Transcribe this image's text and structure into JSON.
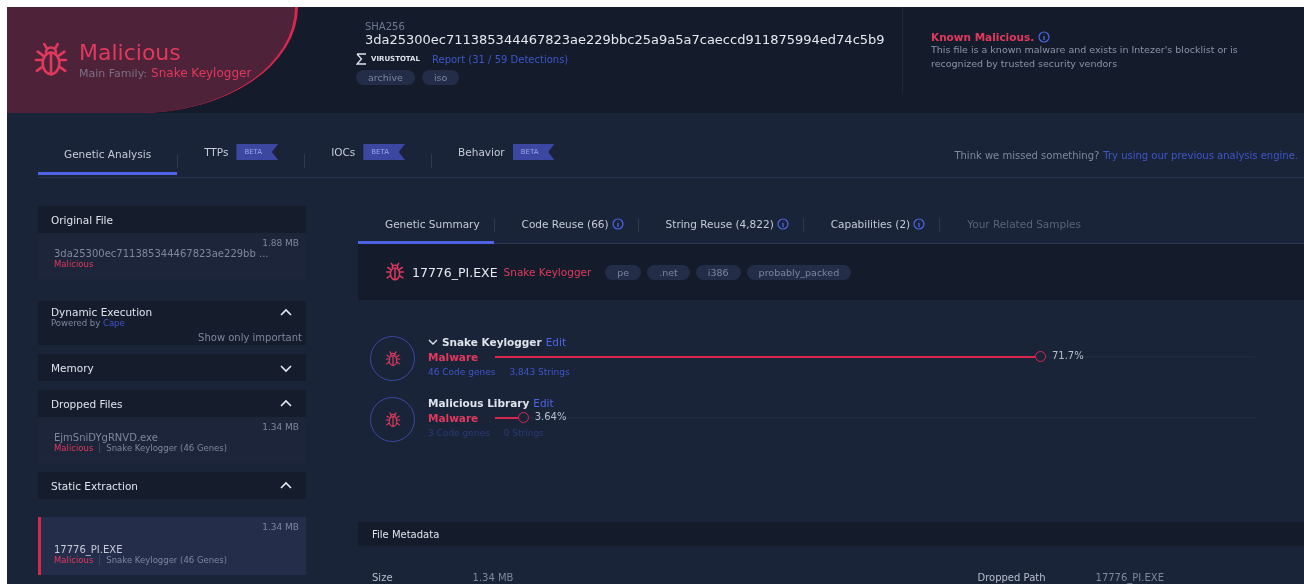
{
  "verdict": {
    "title": "Malicious",
    "family_label": "Main Family:",
    "family": "Snake Keylogger"
  },
  "file": {
    "hash_label": "SHA256",
    "hash": "3da25300ec711385344467823ae229bbc25a9a5a7caeccd911875994ed74c5b9",
    "vt_label": "VIRUSTOTAL",
    "vt_link": "Report (31 / 59 Detections)",
    "tags": [
      "archive",
      "iso"
    ]
  },
  "notice": {
    "title": "Known Malicious.",
    "text": "This file is a known malware and exists in Intezer's blocklist or is recognized by trusted security vendors"
  },
  "tabs": [
    {
      "label": "Genetic Analysis",
      "selected": true
    },
    {
      "label": "TTPs",
      "badge": "BETA",
      "selected": false
    },
    {
      "label": "IOCs",
      "badge": "BETA",
      "selected": false
    },
    {
      "label": "Behavior",
      "badge": "BETA",
      "selected": false
    }
  ],
  "hint": {
    "text": "Think we missed something?",
    "link": "Try using our previous analysis engine."
  },
  "sidebar": {
    "sections": [
      {
        "title": "Original File",
        "kind": "plain",
        "files": [
          {
            "name": "3da25300ec711385344467823ae229bb ...",
            "size": "1.88 MB",
            "verdict": "Malicious",
            "selected": false
          }
        ]
      },
      {
        "title": "Dynamic Execution",
        "kind": "toggle",
        "subtitle": "Powered by",
        "subtitle_link": "Cape",
        "action": "Show only important",
        "expanded": true
      },
      {
        "title": "Memory",
        "kind": "toggle",
        "expanded": false
      },
      {
        "title": "Dropped Files",
        "kind": "toggle",
        "expanded": true,
        "files": [
          {
            "name": "EjmSniDYgRNVD.exe",
            "size": "1.34 MB",
            "verdict": "Malicious",
            "family": "Snake Keylogger (46 Genes)",
            "selected": false
          }
        ]
      },
      {
        "title": "Static Extraction",
        "kind": "toggle",
        "expanded": true,
        "files": [
          {
            "name": "17776_PI.EXE",
            "size": "1.34 MB",
            "verdict": "Malicious",
            "family": "Snake Keylogger (46 Genes)",
            "selected": true
          }
        ]
      }
    ]
  },
  "summary_tabs": [
    {
      "label": "Genetic Summary",
      "info": false,
      "selected": true,
      "disabled": false
    },
    {
      "label": "Code Reuse (66)",
      "info": true,
      "selected": false,
      "disabled": false
    },
    {
      "label": "String Reuse (4,822)",
      "info": true,
      "selected": false,
      "disabled": false
    },
    {
      "label": "Capabilities (2)",
      "info": true,
      "selected": false,
      "disabled": false
    },
    {
      "label": "Your Related Samples",
      "info": false,
      "selected": false,
      "disabled": true
    }
  ],
  "sample": {
    "name": "17776_PI.EXE",
    "family": "Snake Keylogger",
    "tags": [
      "pe",
      ".net",
      "i386",
      "probably_packed"
    ]
  },
  "families": [
    {
      "name": "Snake Keylogger",
      "expandable": true,
      "edit": "Edit",
      "type": "Malware",
      "level": 0.717,
      "reading": "71.7%",
      "genes": "46 Code genes",
      "strings": "3,843 Strings",
      "muted": false
    },
    {
      "name": "Malicious Library",
      "expandable": false,
      "edit": "Edit",
      "type": "Malware",
      "level": 0.0364,
      "reading": "3.64%",
      "genes": "3 Code genes",
      "strings": "0 Strings",
      "muted": true
    }
  ],
  "metadata": {
    "title": "File Metadata",
    "rows": [
      {
        "label": "Size",
        "value": "1.34 MB"
      },
      {
        "label": "Dropped Path",
        "value": "17776_PI.EXE"
      }
    ]
  }
}
